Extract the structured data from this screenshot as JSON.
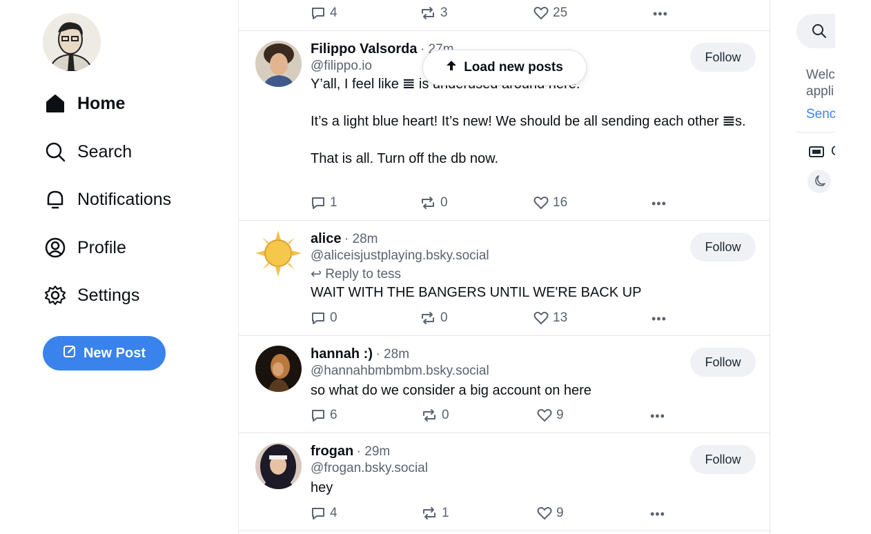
{
  "nav": {
    "items": [
      {
        "label": "Home",
        "icon": "home-icon"
      },
      {
        "label": "Search",
        "icon": "search-icon"
      },
      {
        "label": "Notifications",
        "icon": "bell-icon"
      },
      {
        "label": "Profile",
        "icon": "profile-icon"
      },
      {
        "label": "Settings",
        "icon": "gear-icon"
      }
    ],
    "new_post": "New Post"
  },
  "load_new": "Load new posts",
  "top_actions": {
    "replies": "4",
    "reposts": "3",
    "likes": "25"
  },
  "posts": [
    {
      "name": "Filippo Valsorda",
      "time": "· 27m",
      "handle": "@filippo.io",
      "text": "Y’all, I feel like 𝌆 is underused around here.\n\nIt’s a light blue heart! It’s new! We should be all sending each other 𝌆s.\n\nThat is all. Turn off the db now.",
      "follow": "Follow",
      "replies": "1",
      "reposts": "0",
      "likes": "16"
    },
    {
      "name": "alice",
      "time": "· 28m",
      "handle": "@aliceisjustplaying.bsky.social",
      "reply_to": "Reply to tess",
      "text": "WAIT WITH THE BANGERS UNTIL WE'RE BACK UP",
      "follow": "Follow",
      "replies": "0",
      "reposts": "0",
      "likes": "13"
    },
    {
      "name": "hannah :)",
      "time": "· 28m",
      "handle": "@hannahbmbmbm.bsky.social",
      "text": "so what do we consider a big account on here",
      "follow": "Follow",
      "replies": "6",
      "reposts": "0",
      "likes": "9"
    },
    {
      "name": "frogan",
      "time": "· 29m",
      "handle": "@frogan.bsky.social",
      "text": "hey",
      "follow": "Follow",
      "replies": "4",
      "reposts": "1",
      "likes": "9"
    }
  ],
  "right": {
    "welcome": "Welc\nappli",
    "send": "Senc",
    "feedback": "C"
  },
  "colors": {
    "accent": "#3a82ec",
    "muted": "#5a6270",
    "border": "#e4e6ea"
  }
}
